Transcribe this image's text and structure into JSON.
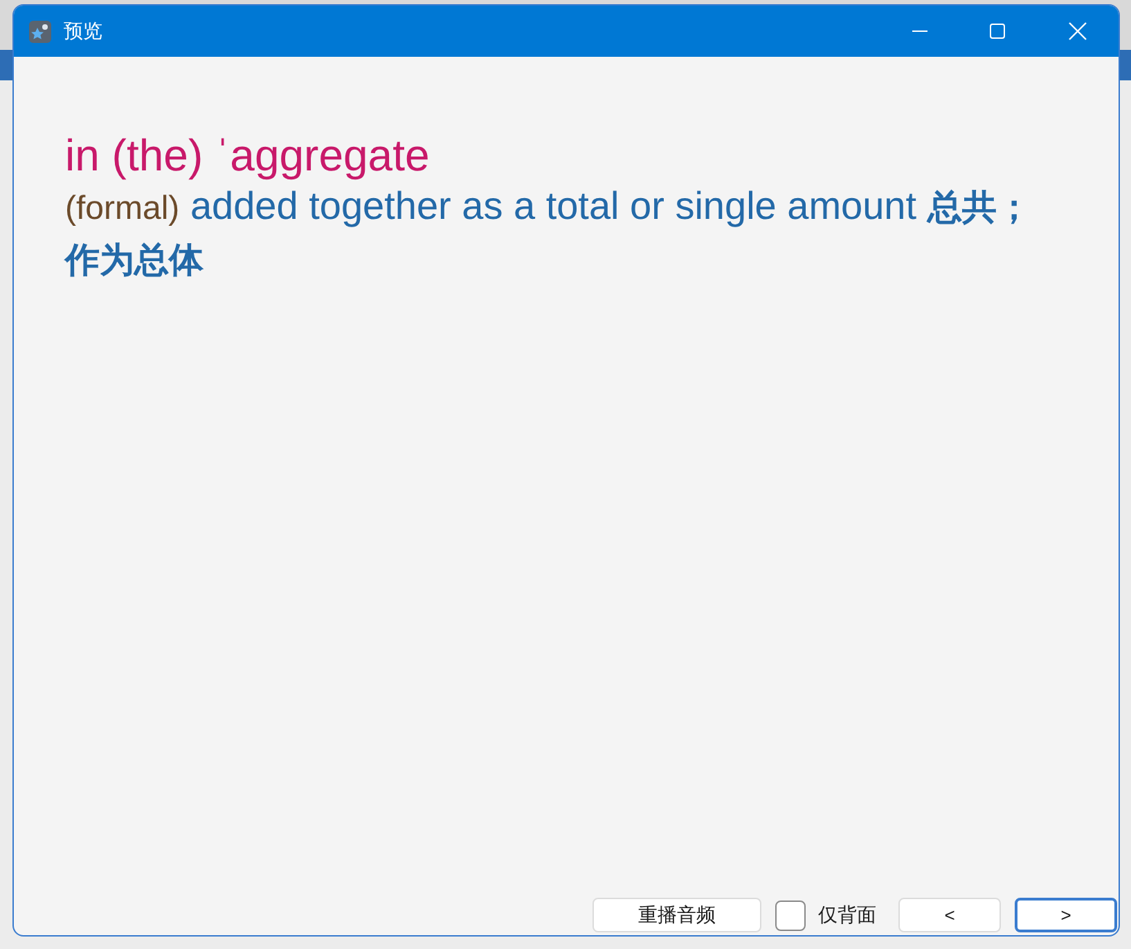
{
  "window": {
    "title": "预览"
  },
  "entry": {
    "headword": "in (the) ˈaggregate",
    "register": "(formal)",
    "definition": "added together as a total or single amount",
    "translation": "总共；作为总体"
  },
  "footer": {
    "replay_button": "重播音频",
    "back_only": {
      "label": "仅背面",
      "checked": false
    },
    "nav_buttons": [
      {
        "label": "<",
        "focused": false
      },
      {
        "label": ">",
        "focused": true
      }
    ]
  }
}
